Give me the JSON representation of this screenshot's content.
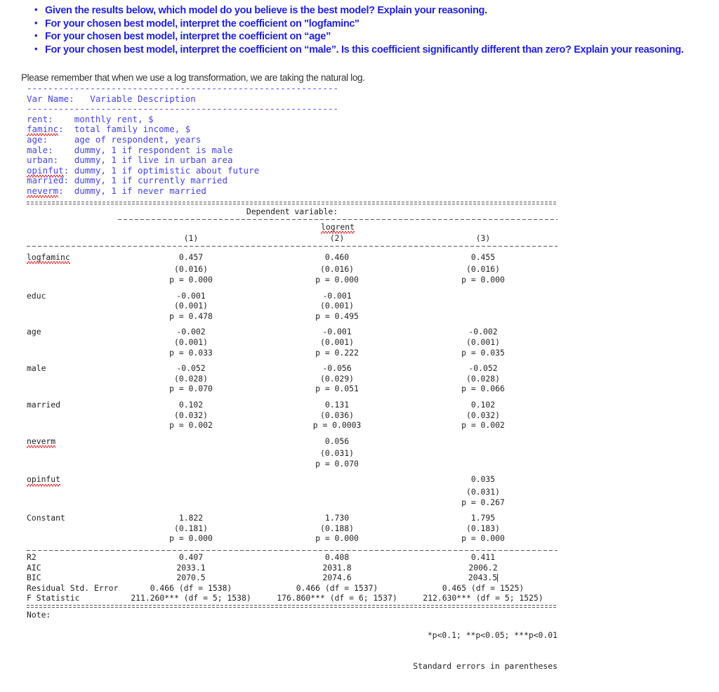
{
  "questions": [
    "Given the results below, which model do you believe is the best model?  Explain your reasoning.",
    "For your chosen best model, interpret the coefficient on \"logfaminc\"",
    "For your chosen best model, interpret the coefficient  on “age”",
    "For your chosen best model, interpret the coefficient on “male”.  Is this coefficient significantly different than zero?  Explain your reasoning."
  ],
  "remember_note": "Please remember that when we use a log transformation, we are taking the natural log.",
  "variable_dictionary": {
    "divider": "-----------------------------------------------------------",
    "header": "Var Name:   Variable Description",
    "rows": [
      {
        "name": "rent:",
        "name_misspelled": false,
        "desc": "monthly rent, $"
      },
      {
        "name": "faminc:",
        "name_misspelled": true,
        "desc": "total family income, $"
      },
      {
        "name": "age:",
        "name_misspelled": false,
        "desc": "age of respondent, years"
      },
      {
        "name": "male:",
        "name_misspelled": false,
        "desc": "dummy, 1 if respondent is male"
      },
      {
        "name": "urban:",
        "name_misspelled": false,
        "desc": "dummy, 1 if live in urban area"
      },
      {
        "name": "opinfut:",
        "name_misspelled": true,
        "desc": "dummy, 1 if optimistic about future"
      },
      {
        "name": "married:",
        "name_misspelled": false,
        "desc": "dummy, 1 if currently married"
      },
      {
        "name": "neverm:",
        "name_misspelled": true,
        "desc": "dummy, 1 if never married"
      }
    ]
  },
  "regression_table": {
    "dependent_variable_header": "Dependent variable:",
    "dependent_variable_name": "logrent",
    "column_headers": [
      "(1)",
      "(2)",
      "(3)"
    ],
    "coefficients": [
      {
        "label": "logfaminc",
        "misspelled": true,
        "estimates": [
          "0.457",
          "0.460",
          "0.455"
        ],
        "std_errors": [
          "(0.016)",
          "(0.016)",
          "(0.016)"
        ],
        "pvalues": [
          "p = 0.000",
          "p = 0.000",
          "p = 0.000"
        ]
      },
      {
        "label": "educ",
        "misspelled": false,
        "estimates": [
          "-0.001",
          "-0.001",
          ""
        ],
        "std_errors": [
          "(0.001)",
          "(0.001)",
          ""
        ],
        "pvalues": [
          "p = 0.478",
          "p = 0.495",
          ""
        ]
      },
      {
        "label": "age",
        "misspelled": false,
        "estimates": [
          "-0.002",
          "-0.001",
          "-0.002"
        ],
        "std_errors": [
          "(0.001)",
          "(0.001)",
          "(0.001)"
        ],
        "pvalues": [
          "p = 0.033",
          "p = 0.222",
          "p = 0.035"
        ]
      },
      {
        "label": "male",
        "misspelled": false,
        "estimates": [
          "-0.052",
          "-0.056",
          "-0.052"
        ],
        "std_errors": [
          "(0.028)",
          "(0.029)",
          "(0.028)"
        ],
        "pvalues": [
          "p = 0.070",
          "p = 0.051",
          "p = 0.066"
        ]
      },
      {
        "label": "married",
        "misspelled": false,
        "estimates": [
          "0.102",
          "0.131",
          "0.102"
        ],
        "std_errors": [
          "(0.032)",
          "(0.036)",
          "(0.032)"
        ],
        "pvalues": [
          "p = 0.002",
          "p = 0.0003",
          "p = 0.002"
        ]
      },
      {
        "label": "neverm",
        "misspelled": true,
        "estimates": [
          "",
          "0.056",
          ""
        ],
        "std_errors": [
          "",
          "(0.031)",
          ""
        ],
        "pvalues": [
          "",
          "p = 0.070",
          ""
        ]
      },
      {
        "label": "opinfut",
        "misspelled": true,
        "estimates": [
          "",
          "",
          "0.035"
        ],
        "std_errors": [
          "",
          "",
          "(0.031)"
        ],
        "pvalues": [
          "",
          "",
          "p = 0.267"
        ]
      },
      {
        "label": "Constant",
        "misspelled": false,
        "estimates": [
          "1.822",
          "1.730",
          "1.795"
        ],
        "std_errors": [
          "(0.181)",
          "(0.188)",
          "(0.183)"
        ],
        "pvalues": [
          "p = 0.000",
          "p = 0.000",
          "p = 0.000"
        ]
      }
    ],
    "statistics": [
      {
        "label": "R2",
        "values": [
          "0.407",
          "0.408",
          "0.411"
        ]
      },
      {
        "label": "AIC",
        "values": [
          "2033.1",
          "2031.8",
          "2006.2"
        ]
      },
      {
        "label": "BIC",
        "values": [
          "2070.5",
          "2074.6",
          "2043.5"
        ]
      },
      {
        "label": "Residual Std. Error",
        "values": [
          "0.466 (df = 1538)",
          "0.466 (df = 1537)",
          "0.465 (df = 1525)"
        ]
      },
      {
        "label": "F Statistic",
        "values": [
          "211.260*** (df = 5; 1538)",
          "176.860*** (df = 6; 1537)",
          "212.630*** (df = 5; 1525)"
        ]
      }
    ],
    "note_label": "Note:",
    "note_significance": "*p<0.1; **p<0.05; ***p<0.01",
    "note_standard_errors": "Standard errors in parentheses"
  },
  "colors": {
    "question_blue": "#2222dd",
    "dictionary_blue": "#4444e4",
    "spellcheck_red": "#e02020",
    "table_text": "#222222"
  }
}
